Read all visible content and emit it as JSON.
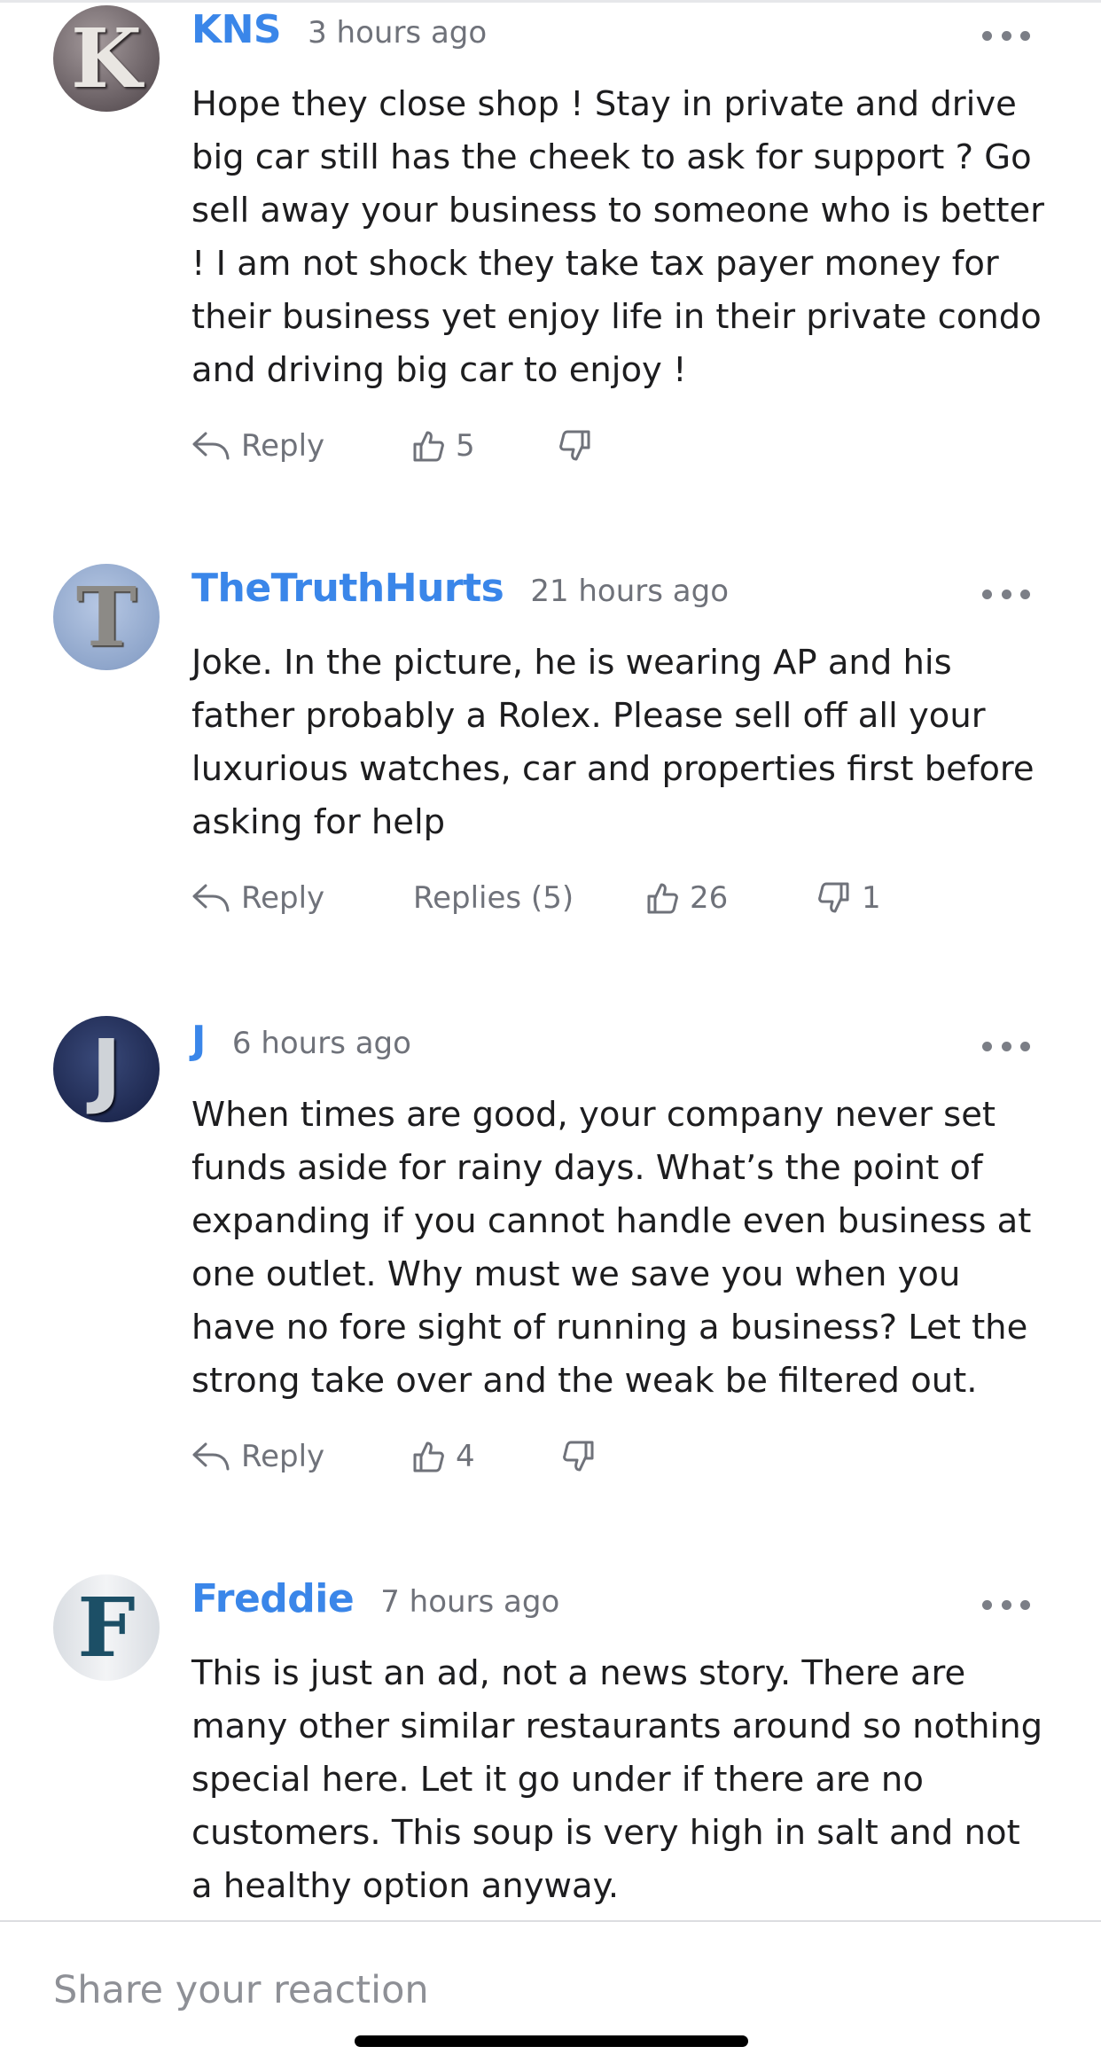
{
  "comments": [
    {
      "avatar_letter": "K",
      "author": "KNS",
      "time": "3 hours ago",
      "text": "Hope they close shop ! Stay in private and drive big car still has the cheek to ask for support ? Go sell away your business to someone who is better ! I am not shock they take tax payer money for their business yet enjoy life in their private condo and driving big car to enjoy !",
      "reply_label": "Reply",
      "likes": "5"
    },
    {
      "avatar_letter": "T",
      "author": "TheTruthHurts",
      "time": "21 hours ago",
      "text": "Joke. In the picture, he is wearing AP and his father probably a Rolex. Please sell off all your luxurious watches, car and properties first before asking for help",
      "reply_label": "Reply",
      "replies_label": "Replies (5)",
      "likes": "26",
      "dislikes": "1"
    },
    {
      "avatar_letter": "J",
      "author": "J",
      "time": "6 hours ago",
      "text": "When times are good, your company never set funds aside for rainy days. What’s the point of expanding if you cannot handle even business at one outlet. Why must we save you when you have no fore sight of running a business? Let the strong take over and the weak be filtered out.",
      "reply_label": "Reply",
      "likes": "4"
    },
    {
      "avatar_letter": "F",
      "author": "Freddie",
      "time": "7 hours ago",
      "text": "This is just an ad, not a news story. There are many other similar restaurants around so nothing special here. Let it go under if there are no customers. This soup is very high in salt and not a healthy option anyway."
    }
  ],
  "reaction_input": {
    "placeholder": "Share your reaction"
  },
  "colors": {
    "author": "#3a86e9",
    "meta": "#6f727a",
    "text": "#1d1d1f"
  },
  "icons": [
    "reply-icon",
    "thumbs-up-icon",
    "thumbs-down-icon",
    "more-options-icon"
  ]
}
